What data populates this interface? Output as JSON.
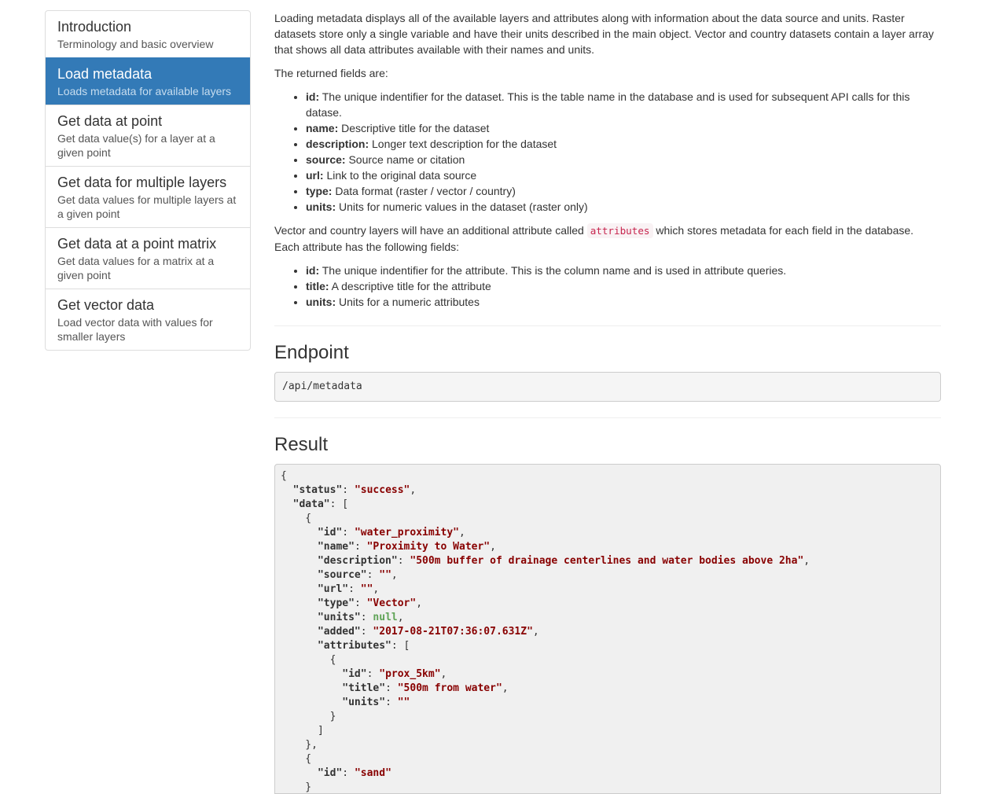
{
  "sidebar": {
    "items": [
      {
        "title": "Introduction",
        "desc": "Terminology and basic overview",
        "active": false
      },
      {
        "title": "Load metadata",
        "desc": "Loads metadata for available layers",
        "active": true
      },
      {
        "title": "Get data at point",
        "desc": "Get data value(s) for a layer at a given point",
        "active": false
      },
      {
        "title": "Get data for multiple layers",
        "desc": "Get data values for multiple layers at a given point",
        "active": false
      },
      {
        "title": "Get data at a point matrix",
        "desc": "Get data values for a matrix at a given point",
        "active": false
      },
      {
        "title": "Get vector data",
        "desc": "Load vector data with values for smaller layers",
        "active": false
      }
    ]
  },
  "main": {
    "intro": "Loading metadata displays all of the available layers and attributes along with information about the data source and units. Raster datasets store only a single variable and have their units described in the main object. Vector and country datasets contain a layer array that shows all data attributes available with their names and units.",
    "fields_intro": "The returned fields are:",
    "fields": [
      {
        "name": "id:",
        "desc": " The unique indentifier for the dataset. This is the table name in the database and is used for subsequent API calls for this datase."
      },
      {
        "name": "name:",
        "desc": " Descriptive title for the dataset"
      },
      {
        "name": "description:",
        "desc": " Longer text description for the dataset"
      },
      {
        "name": "source:",
        "desc": " Source name or citation"
      },
      {
        "name": "url:",
        "desc": " Link to the original data source"
      },
      {
        "name": "type:",
        "desc": " Data format (raster / vector / country)"
      },
      {
        "name": "units:",
        "desc": " Units for numeric values in the dataset (raster only)"
      }
    ],
    "vector_intro_before": "Vector and country layers will have an additional attribute called ",
    "vector_intro_code": "attributes",
    "vector_intro_after": " which stores metadata for each field in the database. Each attribute has the following fields:",
    "attr_fields": [
      {
        "name": "id:",
        "desc": " The unique indentifier for the attribute. This is the column name and is used in attribute queries."
      },
      {
        "name": "title:",
        "desc": " A descriptive title for the attribute"
      },
      {
        "name": "units:",
        "desc": " Units for a numeric attributes"
      }
    ],
    "endpoint_heading": "Endpoint",
    "endpoint_path": "/api/metadata",
    "result_heading": "Result"
  },
  "result_json": {
    "status": "success",
    "data": [
      {
        "id": "water_proximity",
        "name": "Proximity to Water",
        "description": "500m buffer of drainage centerlines and water bodies above 2ha",
        "source": "",
        "url": "",
        "type": "Vector",
        "units": null,
        "added": "2017-08-21T07:36:07.631Z",
        "attributes": [
          {
            "id": "prox_5km",
            "title": "500m from water",
            "units": ""
          }
        ]
      },
      {
        "id": "sand"
      }
    ]
  }
}
